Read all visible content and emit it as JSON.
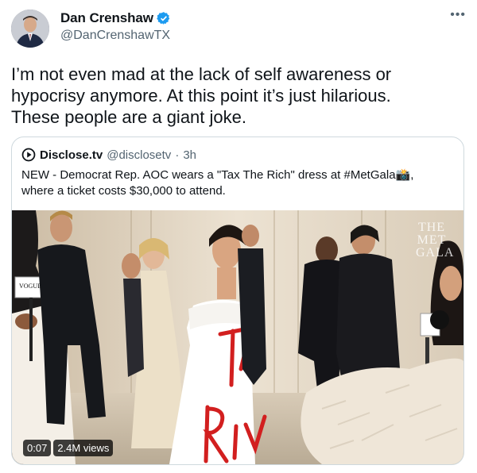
{
  "author": {
    "name": "Dan Crenshaw",
    "handle": "@DanCrenshawTX",
    "verified": true
  },
  "more_icon": "more-horizontal-icon",
  "tweet_text": "I’m not even mad at the lack of self awareness or\nhypocrisy anymore. At this point it’s just hilarious.\nThese people are a giant joke.",
  "quoted": {
    "name": "Disclose.tv",
    "handle": "@disclosetv",
    "separator": "·",
    "time": "3h",
    "text": "NEW - Democrat Rep. AOC wears a \"Tax The Rich\" dress at #MetGala📸,\nwhere a ticket costs $30,000 to attend.",
    "media": {
      "duration": "0:07",
      "views": "2.4M views",
      "watermark": [
        "THE",
        "MET",
        "GALA"
      ],
      "mic_label": "VOGUE"
    }
  },
  "colors": {
    "text": "#0f1419",
    "secondary": "#536471",
    "verified": "#1d9bf0",
    "border": "#cfd9de",
    "dress_text": "#d21f1f"
  }
}
